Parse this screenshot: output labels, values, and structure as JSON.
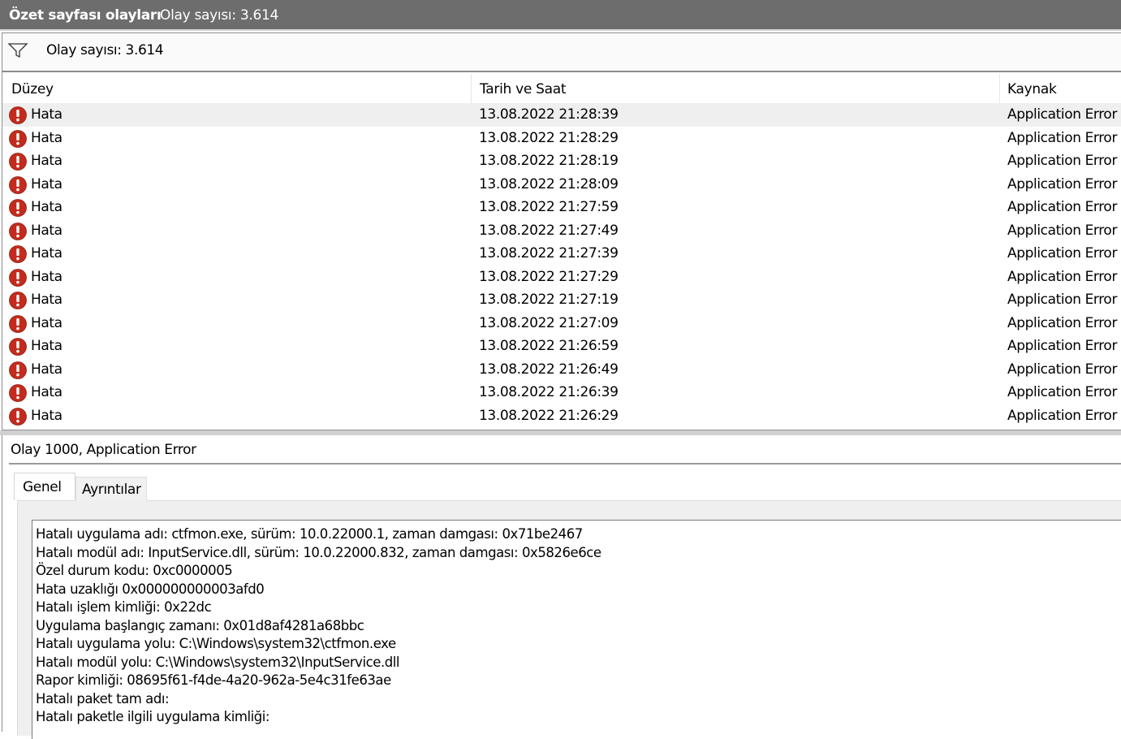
{
  "titlebar": {
    "title": "Özet sayfası olayları",
    "count": "Olay sayısı: 3.614"
  },
  "filterbar": {
    "icon": "filter-icon",
    "count": "Olay sayısı: 3.614"
  },
  "columns": {
    "level": "Düzey",
    "datetime": "Tarih ve Saat",
    "source": "Kaynak"
  },
  "events": [
    {
      "level": "Hata",
      "datetime": "13.08.2022 21:28:39",
      "source": "Application Error"
    },
    {
      "level": "Hata",
      "datetime": "13.08.2022 21:28:29",
      "source": "Application Error"
    },
    {
      "level": "Hata",
      "datetime": "13.08.2022 21:28:19",
      "source": "Application Error"
    },
    {
      "level": "Hata",
      "datetime": "13.08.2022 21:28:09",
      "source": "Application Error"
    },
    {
      "level": "Hata",
      "datetime": "13.08.2022 21:27:59",
      "source": "Application Error"
    },
    {
      "level": "Hata",
      "datetime": "13.08.2022 21:27:49",
      "source": "Application Error"
    },
    {
      "level": "Hata",
      "datetime": "13.08.2022 21:27:39",
      "source": "Application Error"
    },
    {
      "level": "Hata",
      "datetime": "13.08.2022 21:27:29",
      "source": "Application Error"
    },
    {
      "level": "Hata",
      "datetime": "13.08.2022 21:27:19",
      "source": "Application Error"
    },
    {
      "level": "Hata",
      "datetime": "13.08.2022 21:27:09",
      "source": "Application Error"
    },
    {
      "level": "Hata",
      "datetime": "13.08.2022 21:26:59",
      "source": "Application Error"
    },
    {
      "level": "Hata",
      "datetime": "13.08.2022 21:26:49",
      "source": "Application Error"
    },
    {
      "level": "Hata",
      "datetime": "13.08.2022 21:26:39",
      "source": "Application Error"
    },
    {
      "level": "Hata",
      "datetime": "13.08.2022 21:26:29",
      "source": "Application Error"
    }
  ],
  "selected_row_index": 0,
  "detail": {
    "title": "Olay 1000, Application Error",
    "tabs": [
      "Genel",
      "Ayrıntılar"
    ],
    "active_tab": "Genel",
    "lines": [
      "Hatalı uygulama adı: ctfmon.exe, sürüm: 10.0.22000.1, zaman damgası: 0x71be2467",
      "Hatalı modül adı: InputService.dll, sürüm: 10.0.22000.832, zaman damgası: 0x5826e6ce",
      "Özel durum kodu: 0xc0000005",
      "Hata uzaklığı 0x000000000003afd0",
      "Hatalı işlem kimliği: 0x22dc",
      "Uygulama başlangıç zamanı: 0x01d8af4281a68bbc",
      "Hatalı uygulama yolu: C:\\Windows\\system32\\ctfmon.exe",
      "Hatalı modül yolu: C:\\Windows\\system32\\InputService.dll",
      "Rapor kimliği: 08695f61-f4de-4a20-962a-5e4c31fe63ae",
      "Hatalı paket tam adı:",
      "Hatalı paketle ilgili uygulama kimliği:"
    ]
  },
  "colors": {
    "titlebar_bg": "#6d6d6d",
    "error_icon": "#c42b1c",
    "selected_row": "#efefef"
  }
}
